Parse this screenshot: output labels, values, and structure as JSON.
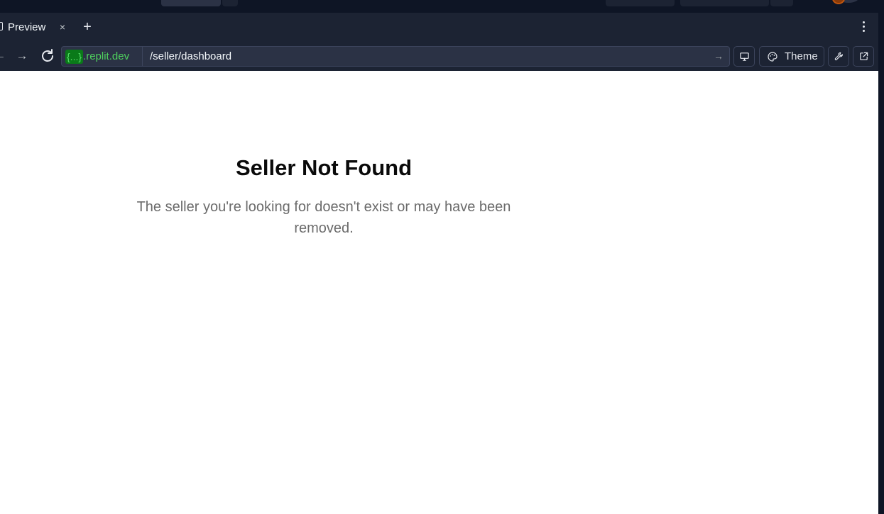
{
  "browser": {
    "tab": {
      "label": "Preview",
      "close_glyph": "×",
      "add_glyph": "+"
    },
    "nav": {
      "back_glyph": "←",
      "forward_glyph": "→",
      "url_badge": "{...}",
      "url_host": ".replit.dev",
      "url_path": "/seller/dashboard",
      "go_glyph": "→"
    },
    "toolbar": {
      "theme_label": "Theme"
    }
  },
  "page": {
    "title": "Seller Not Found",
    "description": "The seller you're looking for doesn't exist or may have been removed."
  },
  "colors": {
    "chrome_bg": "#1c2333",
    "outer_bg": "#0e1525",
    "url_host": "#4fd15e",
    "page_bg": "#ffffff",
    "title": "#0a0a0a",
    "description": "#6b6b6b"
  },
  "icons": {
    "tab": "page-icon",
    "reload": "reload-icon",
    "devices": "monitor-icon",
    "theme": "palette-icon",
    "tools": "wrench-icon",
    "open_external": "external-link-icon",
    "more": "more-vertical-icon"
  }
}
